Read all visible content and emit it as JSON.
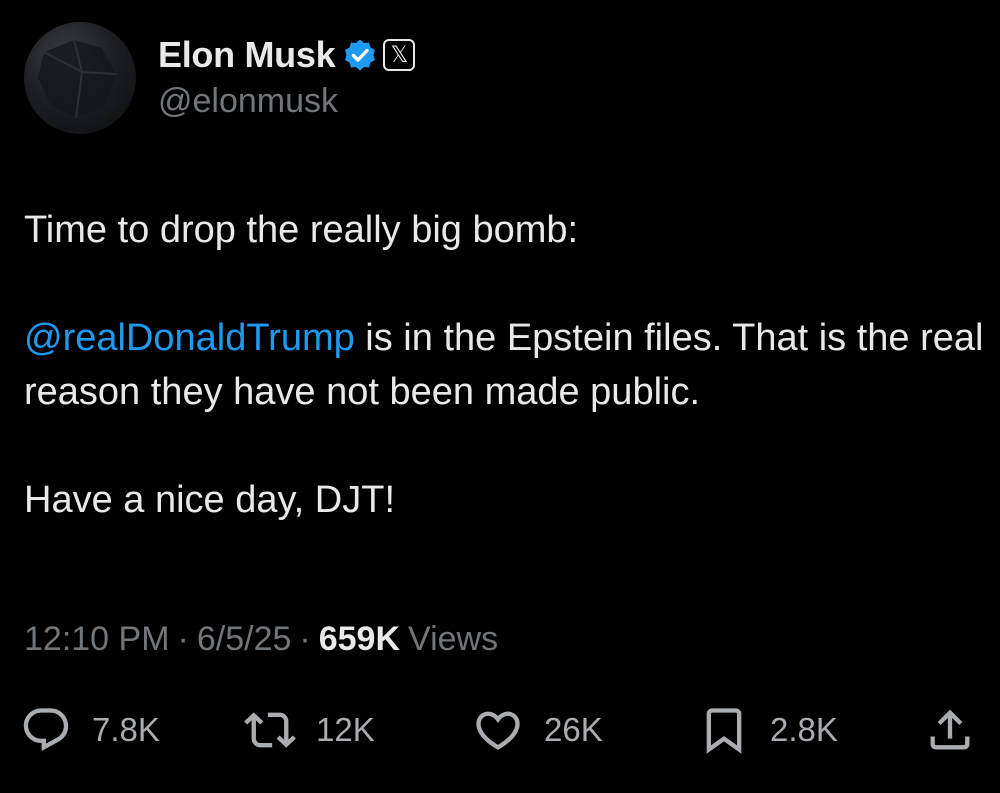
{
  "author": {
    "display_name": "Elon Musk",
    "handle": "@elonmusk",
    "verified_badge_icon": "verified-badge-icon",
    "affiliation_icon": "x-logo-icon",
    "affiliation_glyph": "𝕏"
  },
  "tweet": {
    "paragraphs": [
      {
        "text": "Time to drop the really big bomb:"
      },
      {
        "mention": "@realDonaldTrump",
        "text": " is in the Epstein files. That is the real reason they have not been made public."
      },
      {
        "text": "Have a nice day, DJT!"
      }
    ]
  },
  "meta": {
    "time": "12:10 PM",
    "separator": "·",
    "date": "6/5/25",
    "views_count": "659K",
    "views_label": "Views"
  },
  "actions": {
    "reply": {
      "icon": "reply-icon",
      "count": "7.8K"
    },
    "repost": {
      "icon": "repost-icon",
      "count": "12K"
    },
    "like": {
      "icon": "heart-icon",
      "count": "26K"
    },
    "bookmark": {
      "icon": "bookmark-icon",
      "count": "2.8K"
    },
    "share": {
      "icon": "share-icon"
    }
  },
  "colors": {
    "background": "#000000",
    "primary_text": "#e7e9ea",
    "secondary_text": "#71767b",
    "accent": "#1d9bf0"
  }
}
